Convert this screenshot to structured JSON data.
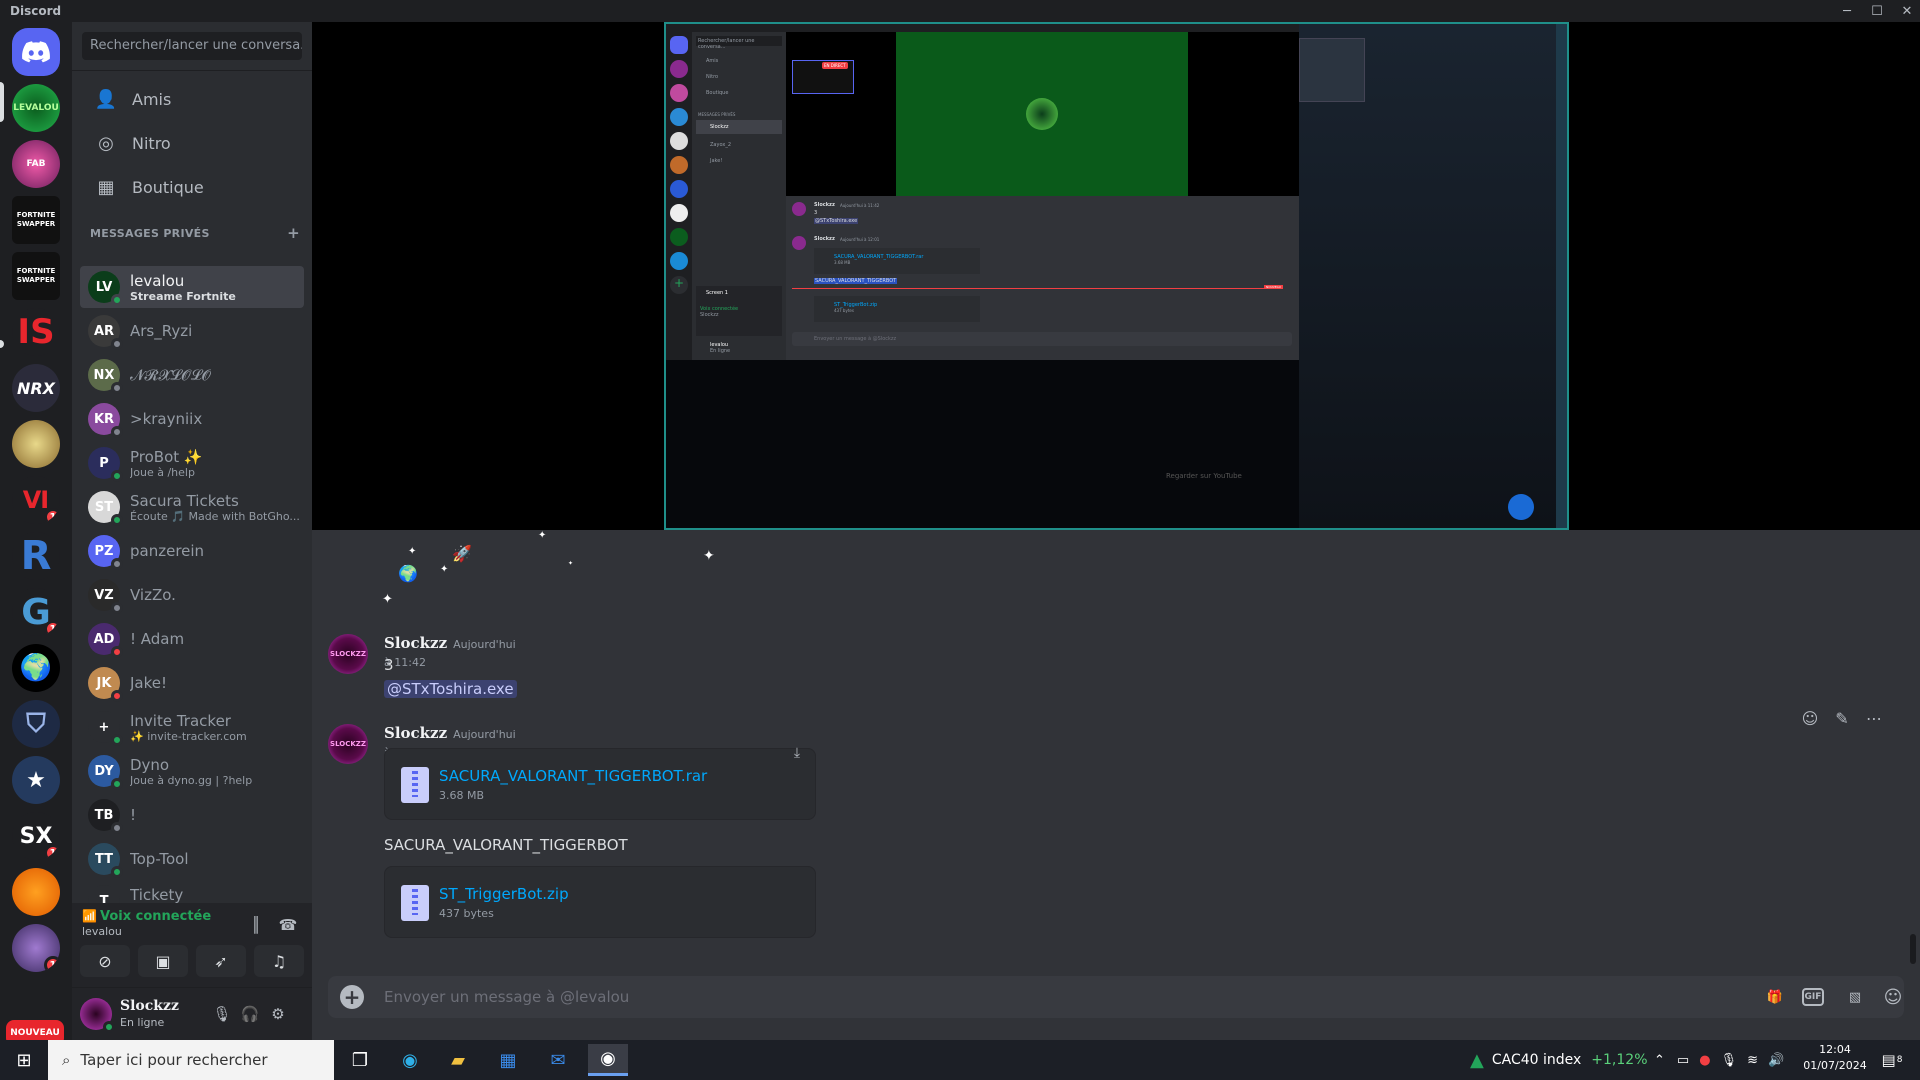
{
  "window": {
    "title": "Discord"
  },
  "colors": {
    "accent": "#5865f2",
    "online": "#23a55a",
    "dnd": "#f23f43",
    "idle": "#f0b232",
    "link": "#00a8fc"
  },
  "rail": {
    "servers": [
      {
        "name": "home",
        "label": "",
        "badge": ""
      },
      {
        "name": "levalou",
        "label": "LEVALOU",
        "badge": ""
      },
      {
        "name": "fabulous",
        "label": "FAB",
        "badge": ""
      },
      {
        "name": "fortnite-swapper-1",
        "label": "FORTNITE SWAPPER",
        "badge": ""
      },
      {
        "name": "fortnite-swapper-2",
        "label": "FORTNITE SWAPPER",
        "badge": ""
      },
      {
        "name": "is",
        "label": "IS",
        "badge": ""
      },
      {
        "name": "nrx",
        "label": "NRX",
        "badge": ""
      },
      {
        "name": "desert",
        "label": "",
        "badge": ""
      },
      {
        "name": "ar",
        "label": "Ⅵ",
        "badge": "1"
      },
      {
        "name": "r",
        "label": "R",
        "badge": ""
      },
      {
        "name": "g",
        "label": "G",
        "badge": "1"
      },
      {
        "name": "globe",
        "label": "",
        "badge": ""
      },
      {
        "name": "shield",
        "label": "",
        "badge": ""
      },
      {
        "name": "police",
        "label": "",
        "badge": ""
      },
      {
        "name": "sx",
        "label": "SX",
        "badge": "1"
      },
      {
        "name": "orange",
        "label": "",
        "badge": ""
      },
      {
        "name": "wolf",
        "label": "",
        "badge": "1"
      },
      {
        "name": "nouveau",
        "label": "NOUVEAU",
        "badge": ""
      }
    ]
  },
  "sidebar": {
    "search_placeholder": "Rechercher/lancer une conversa...",
    "nav": [
      {
        "label": "Amis",
        "icon": "friends-icon"
      },
      {
        "label": "Nitro",
        "icon": "nitro-icon"
      },
      {
        "label": "Boutique",
        "icon": "shop-icon"
      }
    ],
    "dm_header": "MESSAGES PRIVÉS",
    "dms": [
      {
        "name": "levalou",
        "sub": "Streame Fortnite",
        "status": "#23a55a",
        "avatar": "#0b3d1a",
        "initials": "LV"
      },
      {
        "name": "Ars_Ryzi",
        "sub": "",
        "status": "#80848e",
        "avatar": "#3a3a3a",
        "initials": "AR"
      },
      {
        "name": "𝓝𝓡𝓧𝓛𝓞𝓛𝓞",
        "sub": "",
        "status": "#80848e",
        "avatar": "#5c6b4a",
        "initials": "NX"
      },
      {
        "name": ">krayniix",
        "sub": "",
        "status": "#80848e",
        "avatar": "#8a4a9e",
        "initials": "KR"
      },
      {
        "name": "ProBot ✨",
        "sub": "Joue à /help",
        "status": "#23a55a",
        "avatar": "#2b2d5c",
        "initials": "P"
      },
      {
        "name": "Sacura Tickets",
        "sub": "Écoute 🎵 Made with BotGho...",
        "status": "#23a55a",
        "avatar": "#d8d8d8",
        "initials": "ST"
      },
      {
        "name": "panzerein",
        "sub": "",
        "status": "#80848e",
        "avatar": "#5865f2",
        "initials": "PZ"
      },
      {
        "name": "VizZo.",
        "sub": "",
        "status": "#80848e",
        "avatar": "#2a2a2a",
        "initials": "VZ"
      },
      {
        "name": "! Adam",
        "sub": "",
        "status": "#f23f43",
        "avatar": "#4a2a6e",
        "initials": "AD"
      },
      {
        "name": "Jake!",
        "sub": "",
        "status": "#f23f43",
        "avatar": "#c08a50",
        "initials": "JK"
      },
      {
        "name": "Invite Tracker",
        "sub": "✨ invite-tracker.com",
        "status": "#23a55a",
        "avatar": "#2b2d31",
        "initials": "+"
      },
      {
        "name": "Dyno",
        "sub": "Joue à dyno.gg | ?help",
        "status": "#23a55a",
        "avatar": "#2c5aa0",
        "initials": "DY"
      },
      {
        "name": "!",
        "sub": "",
        "status": "#80848e",
        "avatar": "#1e1f22",
        "initials": "TB"
      },
      {
        "name": "Top-Tool",
        "sub": "",
        "status": "#23a55a",
        "avatar": "#2a4a5e",
        "initials": "TT"
      },
      {
        "name": "Tickety",
        "sub": "/help | tickety.top",
        "status": "#23a55a",
        "avatar": "#2b2d31",
        "initials": "T"
      }
    ]
  },
  "voice": {
    "title": "Voix connectée",
    "channel": "levalou"
  },
  "user": {
    "name": "Slockzz",
    "status": "En ligne"
  },
  "chat": {
    "messages": [
      {
        "author": "Slockzz",
        "time": "Aujourd'hui à 11:42",
        "text": "3",
        "mention": "@STxToshira.exe"
      },
      {
        "author": "Slockzz",
        "time": "Aujourd'hui à 12:01",
        "files": [
          {
            "name": "SACURA_VALORANT_TIGGERBOT.rar",
            "size": "3.68 MB"
          },
          {
            "name": "ST_TriggerBot.zip",
            "size": "437 bytes"
          }
        ],
        "text_between": "SACURA_VALORANT_TIGGERBOT"
      }
    ],
    "composer_placeholder": "Envoyer un message à @levalou",
    "composer_gif": "GIF"
  },
  "stream_preview": {
    "live_badge": "EN DIRECT",
    "search_placeholder": "Rechercher/lancer une conversa...",
    "nav": [
      "Amis",
      "Nitro",
      "Boutique"
    ],
    "dm_header": "MESSAGES PRIVÉS",
    "dms": [
      "Slockzz",
      "Zayox_2",
      "Jake!"
    ],
    "screen_label": "Screen 1",
    "voice_label": "Voix connectée",
    "voice_sub": "Slockzz",
    "user_name": "levalou",
    "user_status": "En ligne",
    "msg1_author": "Slockzz",
    "msg1_time": "Aujourd'hui à 11:42",
    "msg1_text": "3",
    "msg1_mention": "@STxToshira.exe",
    "msg2_author": "Slockzz",
    "msg2_time": "Aujourd'hui à 12:01",
    "file1": "SACURA_VALORANT_TIGGERBOT.rar",
    "file1_size": "3.68 MB",
    "file_caption": "SACURA_VALORANT_TIGGERBOT",
    "file2": "ST_TriggerBot.zip",
    "file2_size": "437 bytes",
    "new_badge": "NOUVEAU",
    "composer": "Envoyer un message à @Slockzz",
    "footer": "Regarder sur YouTube"
  },
  "taskbar": {
    "search_placeholder": "Taper ici pour rechercher",
    "stock_name": "CAC40 index",
    "stock_change": "+1,12%",
    "time": "12:04",
    "date": "01/07/2024",
    "notif_count": "8"
  }
}
